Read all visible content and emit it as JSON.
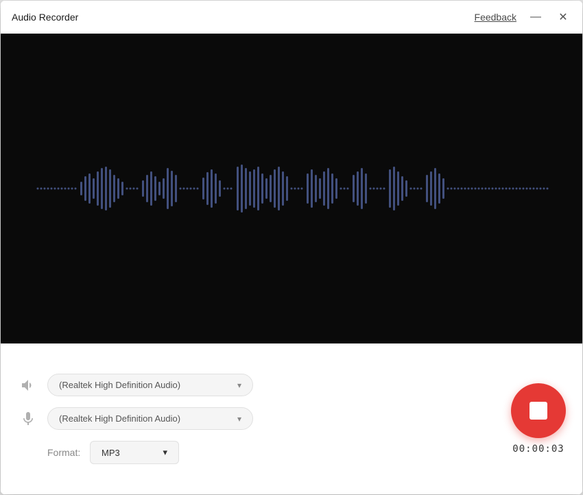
{
  "window": {
    "title": "Audio Recorder",
    "feedback_label": "Feedback",
    "minimize_btn": "—",
    "close_btn": "✕"
  },
  "controls": {
    "speaker_dropdown": "(Realtek High Definition Audio)",
    "mic_dropdown": "(Realtek High Definition Audio)",
    "format_label": "Format:",
    "format_value": "MP3",
    "format_chevron": "▾",
    "speaker_chevron": "▾",
    "mic_chevron": "▾"
  },
  "recorder": {
    "time": "00:00:03"
  },
  "waveform": {
    "color": "#5a6eb0"
  }
}
